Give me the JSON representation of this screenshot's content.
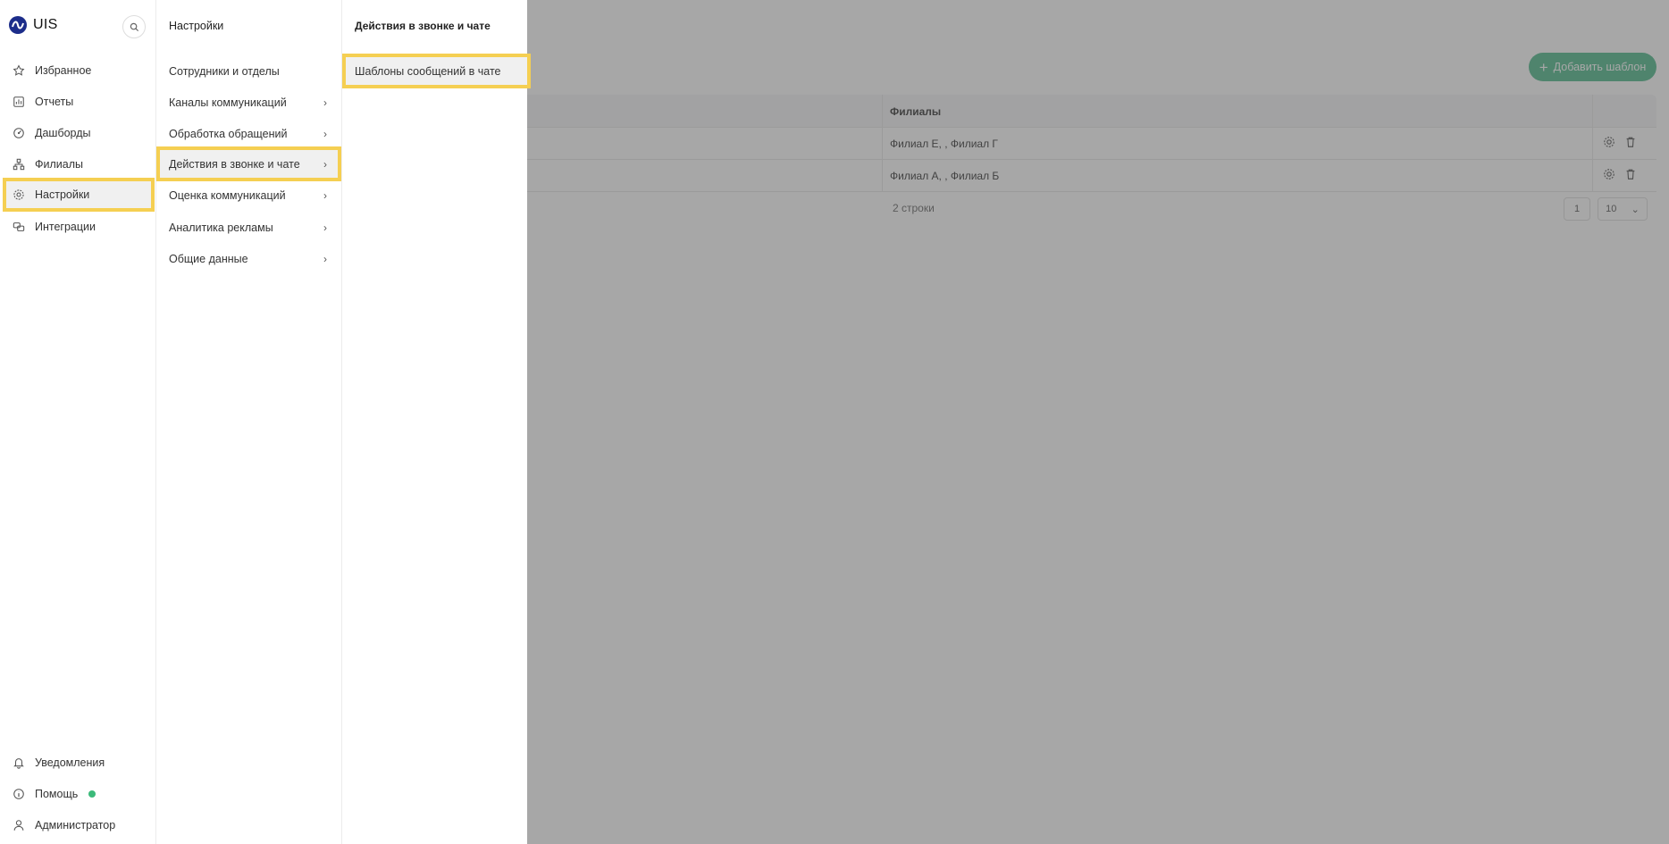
{
  "app": {
    "logo_text": "UIS"
  },
  "sidebar": {
    "items": [
      {
        "label": "Избранное",
        "icon": "star-icon"
      },
      {
        "label": "Отчеты",
        "icon": "report-icon"
      },
      {
        "label": "Дашборды",
        "icon": "dashboard-icon"
      },
      {
        "label": "Филиалы",
        "icon": "branches-icon"
      },
      {
        "label": "Настройки",
        "icon": "gear-icon",
        "active": true
      },
      {
        "label": "Интеграции",
        "icon": "integrations-icon"
      }
    ],
    "bottom": [
      {
        "label": "Уведомления",
        "icon": "bell-icon"
      },
      {
        "label": "Помощь",
        "icon": "info-icon",
        "status_color": "#3cba7a"
      },
      {
        "label": "Администратор",
        "icon": "user-icon"
      }
    ]
  },
  "settings_panel": {
    "title": "Настройки",
    "items": [
      {
        "label": "Сотрудники и отделы",
        "has_children": false
      },
      {
        "label": "Каналы коммуникаций",
        "has_children": true
      },
      {
        "label": "Обработка обращений",
        "has_children": true
      },
      {
        "label": "Действия в звонке и чате",
        "has_children": true,
        "active": true
      },
      {
        "label": "Оценка коммуникаций",
        "has_children": true
      },
      {
        "label": "Аналитика рекламы",
        "has_children": true
      },
      {
        "label": "Общие данные",
        "has_children": true
      }
    ]
  },
  "sub_panel": {
    "title": "Действия в звонке и чате",
    "items": [
      {
        "label": "Шаблоны сообщений в чате",
        "active": true
      }
    ]
  },
  "background": {
    "add_button_label": "Добавить шаблон",
    "table": {
      "column_header": "Филиалы",
      "rows": [
        {
          "branches": "Филиал Е, , Филиал Г"
        },
        {
          "branches": "Филиал А, , Филиал Б"
        }
      ],
      "row_count": "2 строки",
      "page": "1",
      "page_size": "10"
    }
  },
  "colors": {
    "accent": "#4fb98a",
    "highlight": "#f5cf52",
    "logo": "#1c2d8a"
  }
}
